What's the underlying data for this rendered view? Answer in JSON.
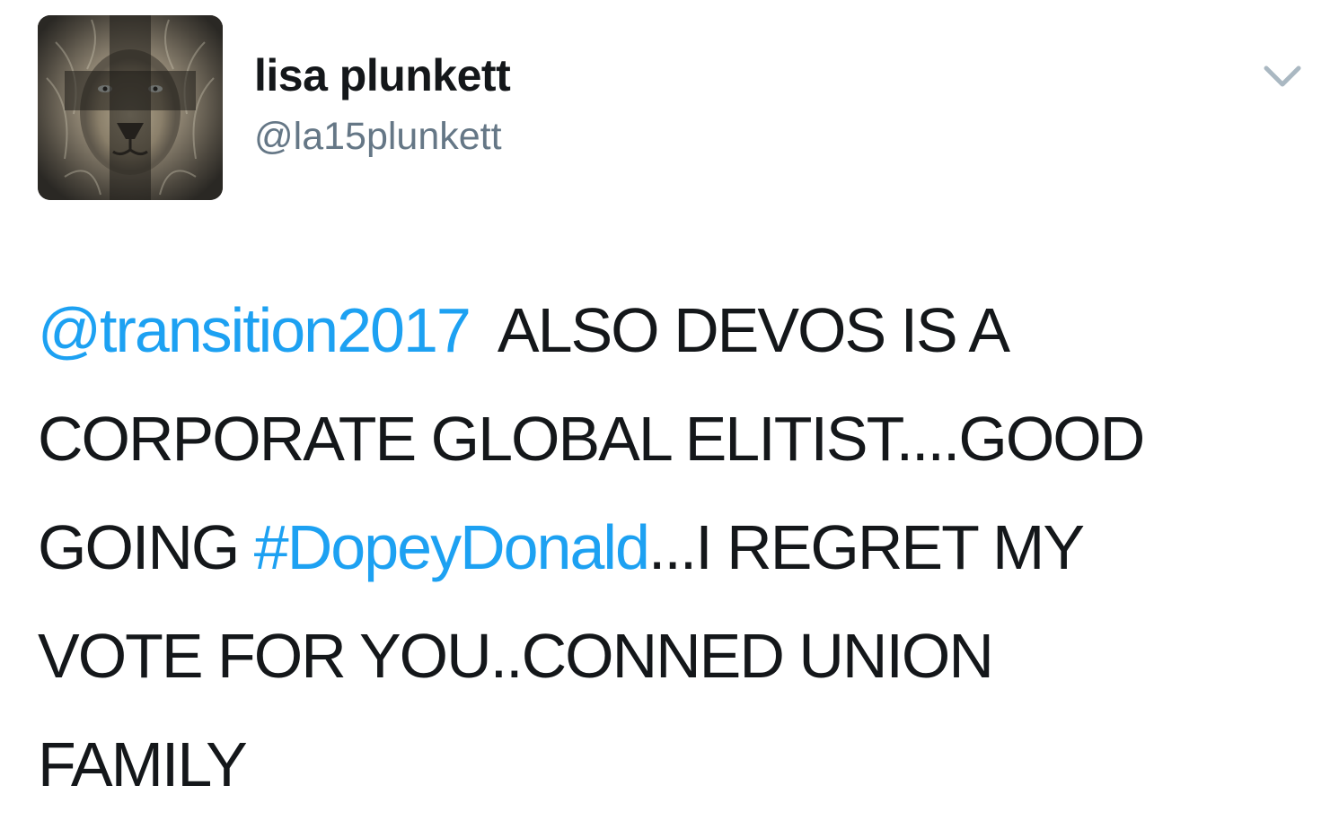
{
  "tweet": {
    "display_name": "lisa plunkett",
    "handle": "@la15plunkett",
    "avatar_icon": "lion-cross-avatar",
    "menu_icon": "chevron-down-icon",
    "colors": {
      "link": "#1da1f2",
      "text": "#14171a",
      "secondary": "#657786"
    },
    "body": {
      "mention": "@transition2017",
      "line1_rest": "ALSO DEVOS IS A",
      "line2": "CORPORATE GLOBAL ELITIST....GOOD",
      "line3_start": "GOING ",
      "hashtag": "#DopeyDonald",
      "line3_rest": "...I REGRET MY",
      "line4": "VOTE FOR YOU..CONNED UNION",
      "line5": "FAMILY"
    }
  }
}
